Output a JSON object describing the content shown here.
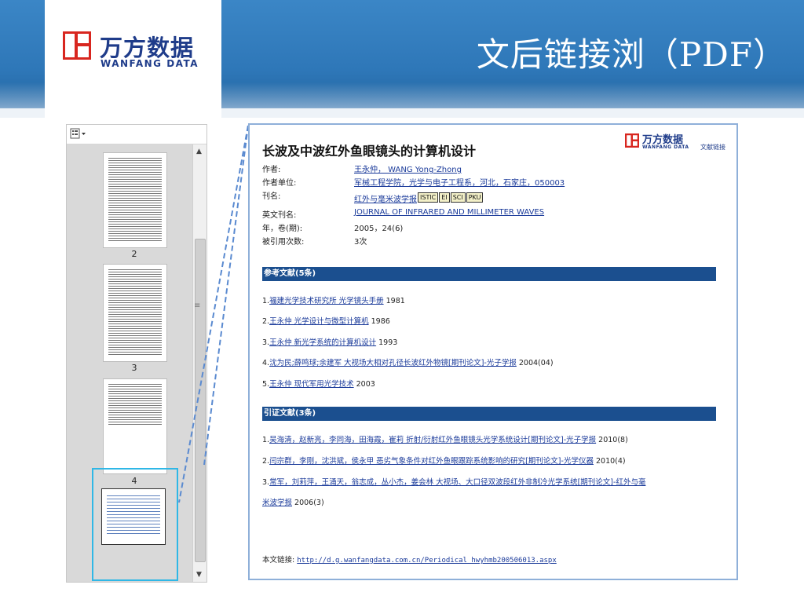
{
  "slide": {
    "title": "文后链接浏（PDF）",
    "logo": {
      "cn": "万方数据",
      "en": "WANFANG DATA"
    }
  },
  "side_panel": {
    "toolbar_icon": "thumbnail-options-icon",
    "thumbnails": [
      {
        "label": "2"
      },
      {
        "label": "3"
      },
      {
        "label": "4"
      }
    ]
  },
  "doc": {
    "title": "长波及中波红外鱼眼镜头的计算机设计",
    "logo": {
      "cn": "万方数据",
      "en": "WANFANG DATA",
      "link": "文献链接"
    },
    "meta": [
      {
        "label": "作者:",
        "value": "王永仲， WANG Yong-Zhong"
      },
      {
        "label": "作者单位:",
        "value": "军械工程学院，光学与电子工程系，河北，石家庄，050003"
      },
      {
        "label": "刊名:",
        "value": "红外与毫米波学报",
        "badges": [
          "ISTIC",
          "EI",
          "SCI",
          "PKU"
        ]
      },
      {
        "label": "英文刊名:",
        "value": "JOURNAL OF INFRARED AND MILLIMETER WAVES"
      },
      {
        "label": "年，卷(期):",
        "value": "2005，24(6)"
      },
      {
        "label": "被引用次数:",
        "value": "3次"
      }
    ],
    "references_header": "参考文献(5条)",
    "references": [
      {
        "n": "1.",
        "text": "福建光学技术研究所 光学镜头手册",
        "year": "1981"
      },
      {
        "n": "2.",
        "text": "王永仲 光学设计与微型计算机",
        "year": "1986"
      },
      {
        "n": "3.",
        "text": "王永仲 新光学系统的计算机设计",
        "year": "1993"
      },
      {
        "n": "4.",
        "text": "沈为民;薛鸣球;余建军 大视场大相对孔径长波红外物镜[期刊论文]-光子学报",
        "year": "2004(04)"
      },
      {
        "n": "5.",
        "text": "王永仲 现代军用光学技术",
        "year": "2003"
      }
    ],
    "citations_header": "引证文献(3条)",
    "citations": [
      {
        "n": "1.",
        "text": "吴海清，赵新亮，李同海，田海霞，崔莉 折射/衍射红外鱼眼镜头光学系统设计[期刊论文]-光子学报",
        "year": "2010(8)"
      },
      {
        "n": "2.",
        "text": "闫宗群，李刚，沈洪斌，侯永甲 恶劣气象条件对红外鱼眼跟踪系统影响的研究[期刊论文]-光学仪器",
        "year": "2010(4)"
      },
      {
        "n": "3.",
        "text": "常军，刘莉萍，王涌天，翁志成，丛小杰，姜会林 大视场、大口径双波段红外非制冷光学系统[期刊论文]-红外与毫",
        "year": ""
      },
      {
        "n": "",
        "text": "米波学报",
        "year": "2006(3)"
      }
    ],
    "footer": {
      "label": "本文链接:",
      "url": "http://d.g.wanfangdata.com.cn/Periodical_hwyhmb200506013.aspx"
    }
  }
}
